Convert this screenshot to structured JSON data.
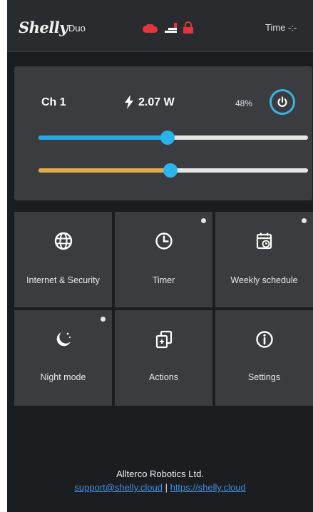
{
  "header": {
    "logo": "Shelly",
    "model": "Duo",
    "time_label": "Time -:-",
    "status_icons": [
      "cloud-icon",
      "wifi-icon",
      "lock-icon"
    ],
    "status_color": "#e5343d"
  },
  "channel": {
    "name": "Ch 1",
    "power": "2.07 W",
    "brightness_label": "48%",
    "brightness_level": 0.48,
    "color_temp_level": 0.49,
    "accent": "#3ab4e6",
    "temp_color": "#e2ac4c"
  },
  "tiles": [
    {
      "label": "Internet & Security",
      "icon": "globe-icon",
      "dot": false
    },
    {
      "label": "Timer",
      "icon": "clock-icon",
      "dot": true
    },
    {
      "label": "Weekly schedule",
      "icon": "calendar-icon",
      "dot": true
    },
    {
      "label": "Night mode",
      "icon": "moon-icon",
      "dot": true
    },
    {
      "label": "Actions",
      "icon": "actions-icon",
      "dot": false
    },
    {
      "label": "Settings",
      "icon": "info-icon",
      "dot": false
    }
  ],
  "footer": {
    "company": "Allterco Robotics Ltd.",
    "email": "support@shelly.cloud",
    "separator": "|",
    "website": "https://shelly.cloud"
  }
}
